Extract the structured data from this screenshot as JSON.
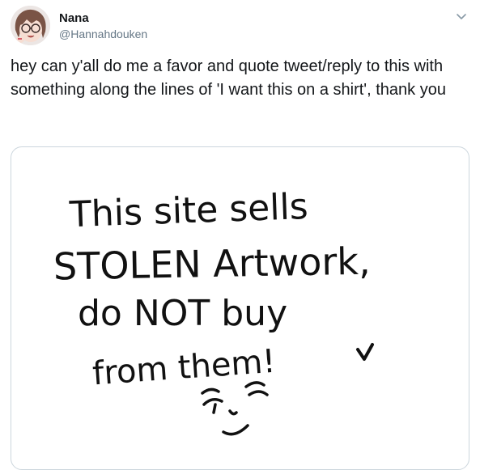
{
  "tweet": {
    "author": {
      "display_name": "Nana",
      "handle": "@Hannahdouken"
    },
    "text": "hey can y'all do me a favor and quote tweet/reply to this with something along the lines of 'I want this on a shirt', thank you",
    "menu_icon": "chevron-down-icon",
    "media": {
      "lines": [
        "This site sells",
        "STOLEN Artwork,",
        "do NOT buy",
        "from them!"
      ]
    }
  }
}
